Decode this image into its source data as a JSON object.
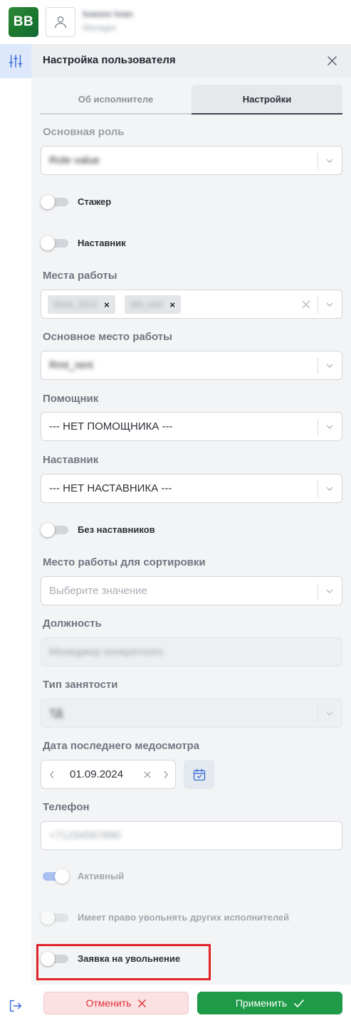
{
  "app": {
    "logo_text": "BB",
    "accent": "#1e9a48",
    "highlight_color": "#e0242a"
  },
  "user": {
    "name": "Ivanov Ivan",
    "subtitle": "Manager"
  },
  "panel": {
    "title": "Настройка пользователя",
    "tabs": [
      {
        "label": "Об исполнителе",
        "active": false
      },
      {
        "label": "Настройки",
        "active": true
      }
    ]
  },
  "form": {
    "main_role": {
      "label": "Основная роль",
      "value": "Role value"
    },
    "trainee": {
      "label": "Стажер",
      "on": false
    },
    "mentor_toggle": {
      "label": "Наставник",
      "on": false
    },
    "workplaces": {
      "label": "Места работы",
      "chips": [
        "Work_2010",
        "Wh_rent"
      ]
    },
    "main_workplace": {
      "label": "Основное место работы",
      "value": "Rmt_rent"
    },
    "assistant": {
      "label": "Помощник",
      "value": "--- НЕТ ПОМОЩНИКА ---"
    },
    "mentor": {
      "label": "Наставник",
      "value": "--- НЕТ НАСТАВНИКА ---"
    },
    "no_mentors": {
      "label": "Без наставников",
      "on": false
    },
    "sort_workplace": {
      "label": "Место работы для сортировки",
      "placeholder": "Выберите значение"
    },
    "position": {
      "label": "Должность",
      "value": "Менеджер конкретного"
    },
    "employment_type": {
      "label": "Тип занятости",
      "value": "ТД"
    },
    "medical_date": {
      "label": "Дата последнего медосмотра",
      "value": "01.09.2024"
    },
    "phone": {
      "label": "Телефон",
      "value": "+71234567890"
    },
    "active": {
      "label": "Активный",
      "on": true
    },
    "can_dismiss": {
      "label": "Имеет право увольнять других исполнителей",
      "on": false
    },
    "resignation_request": {
      "label": "Заявка на увольнение",
      "on": false
    }
  },
  "footer": {
    "cancel_label": "Отменить",
    "apply_label": "Применить"
  },
  "icons": {
    "rail_tool": "sliders-icon",
    "rail_exit": "logout-icon",
    "close": "close-icon",
    "calendar": "calendar-icon"
  }
}
